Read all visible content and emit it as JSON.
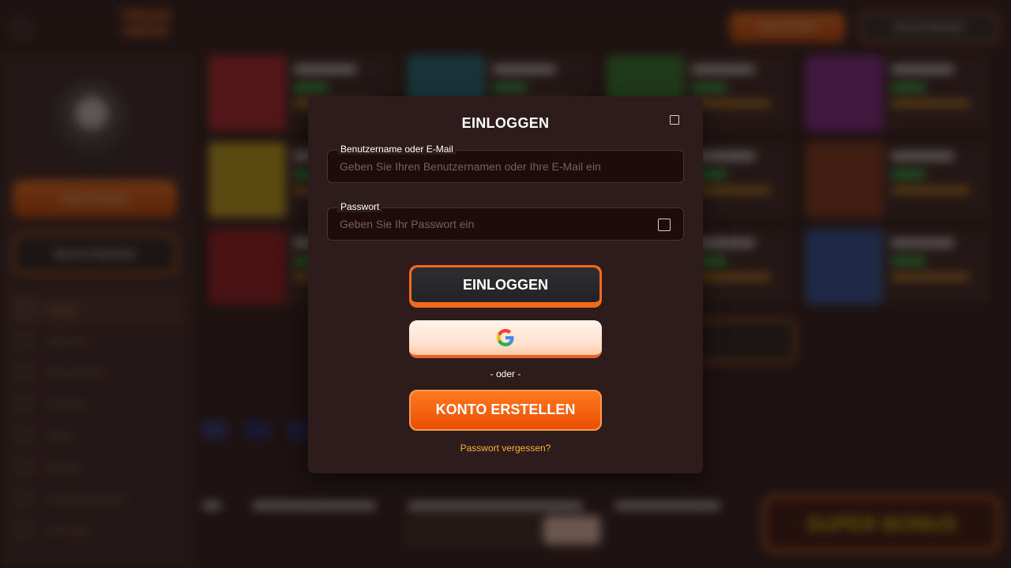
{
  "background": {
    "logo_text": "VEGAS SPINS",
    "header": {
      "login_label": "EINLOGGEN",
      "register_label": "REGISTRIEREN"
    },
    "sidebar": {
      "login_label": "EINLOGGEN",
      "register_label": "REGISTRIEREN",
      "nav_items": [
        {
          "label": "Lobby",
          "icon": "home-icon",
          "active": true
        },
        {
          "label": "Aktionen",
          "icon": "megaphone-icon"
        },
        {
          "label": "Bonuskonto",
          "icon": "gift-icon"
        },
        {
          "label": "Turniere",
          "icon": "trophy-icon"
        },
        {
          "label": "Shop",
          "icon": "shop-icon"
        },
        {
          "label": "Erfolge",
          "icon": "medal-icon"
        },
        {
          "label": "Treueprogramm",
          "icon": "star-icon"
        },
        {
          "label": "VIP-Club",
          "icon": "crown-icon"
        }
      ]
    },
    "super_bonus_label": "SUPER BONUS",
    "colors": {
      "game_thumbs": [
        "#c0262a",
        "#1e7a86",
        "#2f8a2a",
        "#8a2a9a",
        "#d6b21a",
        "#3a2a6a",
        "#2a5a3a",
        "#8a3a1a",
        "#a41a1a",
        "#7a2a2a",
        "#3a4a2a",
        "#2a5aa8"
      ],
      "flags": [
        "#2a3a8a",
        "#1a2a7a",
        "#1a2a7a",
        "#4a5aa0",
        "#d41a2a",
        "#8a2a3a",
        "#2a9a3a",
        "#d41a1a",
        "#f0a800",
        "#d41a4a"
      ]
    }
  },
  "modal": {
    "title": "EINLOGGEN",
    "close_icon": "close-icon",
    "username": {
      "label": "Benutzername oder E-Mail",
      "placeholder": "Geben Sie Ihren Benutzernamen oder Ihre E-Mail ein",
      "value": ""
    },
    "password": {
      "label": "Passwort",
      "placeholder": "Geben Sie Ihr Passwort ein",
      "value": "",
      "toggle_icon": "show-password-icon"
    },
    "login_button": "EINLOGGEN",
    "google_icon": "google-icon",
    "separator": "- oder -",
    "create_account_button": "KONTO ERSTELLEN",
    "forgot_password_link": "Passwort vergessen?"
  }
}
